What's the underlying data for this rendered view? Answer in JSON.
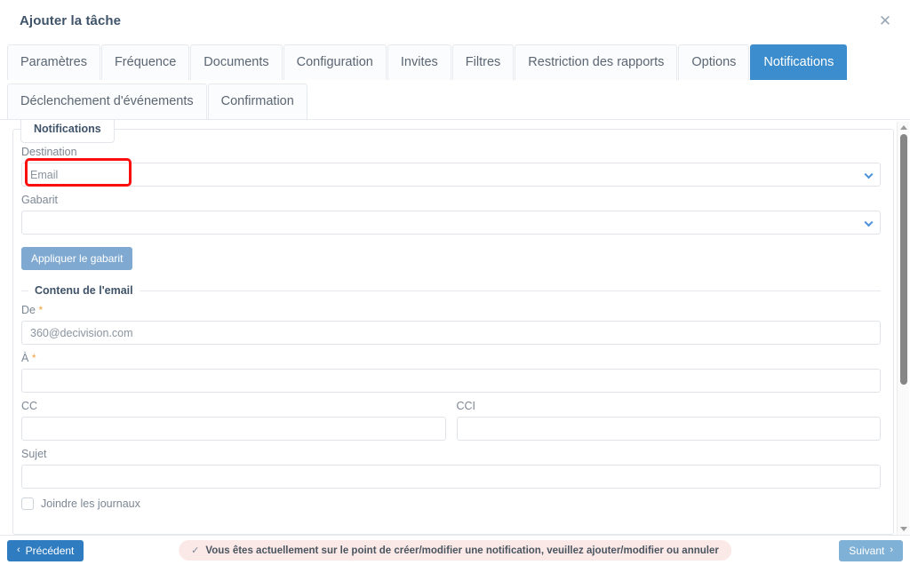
{
  "header": {
    "title": "Ajouter la tâche",
    "close_label": "✕"
  },
  "tabs": [
    {
      "label": "Paramètres",
      "active": false
    },
    {
      "label": "Fréquence",
      "active": false
    },
    {
      "label": "Documents",
      "active": false
    },
    {
      "label": "Configuration",
      "active": false
    },
    {
      "label": "Invites",
      "active": false
    },
    {
      "label": "Filtres",
      "active": false
    },
    {
      "label": "Restriction des rapports",
      "active": false
    },
    {
      "label": "Options",
      "active": false
    },
    {
      "label": "Notifications",
      "active": true
    },
    {
      "label": "Déclenchement d'événements",
      "active": false
    },
    {
      "label": "Confirmation",
      "active": false
    }
  ],
  "panel": {
    "tab_label": "Notifications",
    "destination": {
      "label": "Destination",
      "value": "Email",
      "placeholder": "Email"
    },
    "gabarit": {
      "label": "Gabarit",
      "value": "",
      "placeholder": ""
    },
    "apply_template_button": "Appliquer le gabarit",
    "email_group": {
      "legend": "Contenu de l'email",
      "from": {
        "label": "De",
        "required_marker": "*",
        "value": "360@decivision.com"
      },
      "to": {
        "label": "À",
        "required_marker": "*",
        "value": ""
      },
      "cc": {
        "label": "CC",
        "value": ""
      },
      "bcc": {
        "label": "CCI",
        "value": ""
      },
      "subject": {
        "label": "Sujet",
        "value": ""
      },
      "attach_logs": {
        "label": "Joindre les journaux",
        "checked": false
      }
    }
  },
  "footer": {
    "previous_button": "Précédent",
    "next_button": "Suivant",
    "alert_message": "Vous êtes actuellement sur le point de créer/modifier une notification, veuillez ajouter/modifier ou annuler",
    "alert_icon": "✓"
  },
  "colors": {
    "accent": "#3c8dcd",
    "primary_button": "#2f7cc0",
    "muted_button": "#7fb0d6",
    "apply_button": "#7fa9d0",
    "highlight_box": "#fb0e0e",
    "alert_bg": "#fbe9e7",
    "required": "#f0a13c"
  },
  "scroll": {
    "up_arrow": "up-arrow",
    "down_arrow": "down-arrow"
  }
}
